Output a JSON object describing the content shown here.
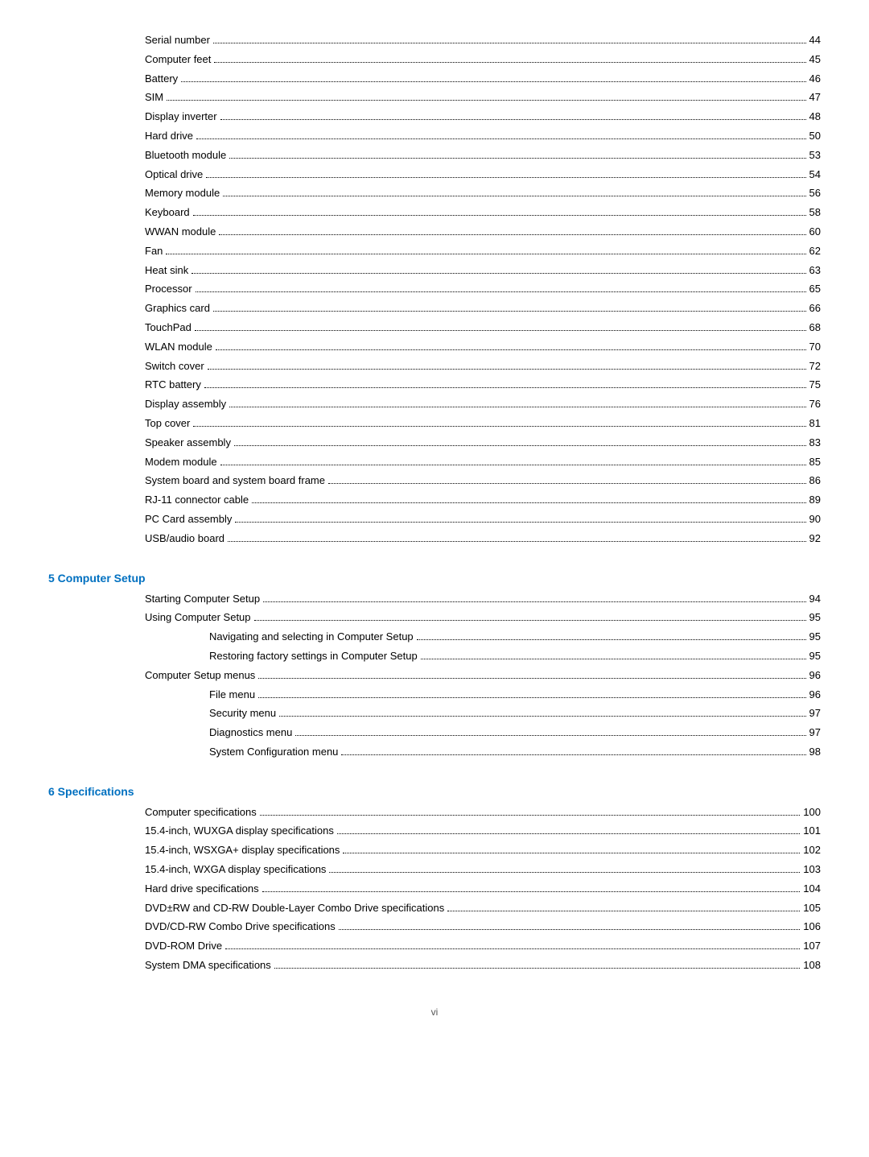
{
  "toc": {
    "top_entries": [
      {
        "label": "Serial number",
        "page": "44",
        "indent": 1
      },
      {
        "label": "Computer feet",
        "page": "45",
        "indent": 1
      },
      {
        "label": "Battery",
        "page": "46",
        "indent": 1
      },
      {
        "label": "SIM",
        "page": "47",
        "indent": 1
      },
      {
        "label": "Display inverter",
        "page": "48",
        "indent": 1
      },
      {
        "label": "Hard drive",
        "page": "50",
        "indent": 1
      },
      {
        "label": "Bluetooth module",
        "page": "53",
        "indent": 1
      },
      {
        "label": "Optical drive",
        "page": "54",
        "indent": 1
      },
      {
        "label": "Memory module",
        "page": "56",
        "indent": 1
      },
      {
        "label": "Keyboard",
        "page": "58",
        "indent": 1
      },
      {
        "label": "WWAN module",
        "page": "60",
        "indent": 1
      },
      {
        "label": "Fan",
        "page": "62",
        "indent": 1
      },
      {
        "label": "Heat sink",
        "page": "63",
        "indent": 1
      },
      {
        "label": "Processor",
        "page": "65",
        "indent": 1
      },
      {
        "label": "Graphics card",
        "page": "66",
        "indent": 1
      },
      {
        "label": "TouchPad",
        "page": "68",
        "indent": 1
      },
      {
        "label": "WLAN module",
        "page": "70",
        "indent": 1
      },
      {
        "label": "Switch cover",
        "page": "72",
        "indent": 1
      },
      {
        "label": "RTC battery",
        "page": "75",
        "indent": 1
      },
      {
        "label": "Display assembly",
        "page": "76",
        "indent": 1
      },
      {
        "label": "Top cover",
        "page": "81",
        "indent": 1
      },
      {
        "label": "Speaker assembly",
        "page": "83",
        "indent": 1
      },
      {
        "label": "Modem module",
        "page": "85",
        "indent": 1
      },
      {
        "label": "System board and system board frame",
        "page": "86",
        "indent": 1
      },
      {
        "label": "RJ-11 connector cable",
        "page": "89",
        "indent": 1
      },
      {
        "label": "PC Card assembly",
        "page": "90",
        "indent": 1
      },
      {
        "label": "USB/audio board",
        "page": "92",
        "indent": 1
      }
    ],
    "section5": {
      "title": "5  Computer Setup",
      "entries": [
        {
          "label": "Starting Computer Setup",
          "page": "94",
          "indent": 1
        },
        {
          "label": "Using Computer Setup",
          "page": "95",
          "indent": 1
        },
        {
          "label": "Navigating and selecting in Computer Setup",
          "page": "95",
          "indent": 2
        },
        {
          "label": "Restoring factory settings in Computer Setup",
          "page": "95",
          "indent": 2
        },
        {
          "label": "Computer Setup menus",
          "page": "96",
          "indent": 1
        },
        {
          "label": "File menu",
          "page": "96",
          "indent": 2
        },
        {
          "label": "Security menu",
          "page": "97",
          "indent": 2
        },
        {
          "label": "Diagnostics menu",
          "page": "97",
          "indent": 2
        },
        {
          "label": "System Configuration menu",
          "page": "98",
          "indent": 2
        }
      ]
    },
    "section6": {
      "title": "6  Specifications",
      "entries": [
        {
          "label": "Computer specifications",
          "page": "100",
          "indent": 1
        },
        {
          "label": "15.4-inch, WUXGA display specifications",
          "page": "101",
          "indent": 1
        },
        {
          "label": "15.4-inch, WSXGA+ display specifications",
          "page": "102",
          "indent": 1
        },
        {
          "label": "15.4-inch, WXGA display specifications",
          "page": "103",
          "indent": 1
        },
        {
          "label": "Hard drive specifications",
          "page": "104",
          "indent": 1
        },
        {
          "label": "DVD±RW and CD-RW Double-Layer Combo Drive specifications",
          "page": "105",
          "indent": 1
        },
        {
          "label": "DVD/CD-RW Combo Drive specifications",
          "page": "106",
          "indent": 1
        },
        {
          "label": "DVD-ROM Drive",
          "page": "107",
          "indent": 1
        },
        {
          "label": "System DMA specifications",
          "page": "108",
          "indent": 1
        }
      ]
    }
  },
  "footer": {
    "text": "vi"
  }
}
